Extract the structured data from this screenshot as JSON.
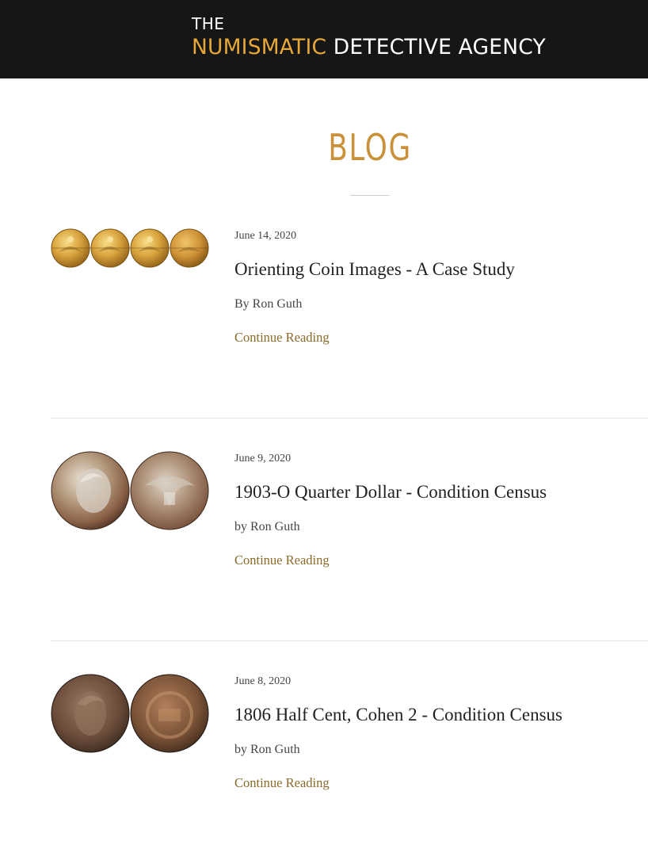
{
  "header": {
    "logo_top": "THE",
    "logo_accent": "NUMISMATIC",
    "logo_rest": "DETECTIVE AGENCY"
  },
  "page": {
    "title": "BLOG"
  },
  "posts": [
    {
      "date": "June 14, 2020",
      "title": "Orienting Coin Images - A Case Study",
      "author": "By Ron Guth",
      "link": "Continue Reading",
      "thumb": {
        "coins": 4,
        "style": "gold"
      }
    },
    {
      "date": "June 9, 2020",
      "title": "1903-O Quarter Dollar - Condition Census",
      "author": "by Ron Guth",
      "link": "Continue Reading",
      "thumb": {
        "coins": 2,
        "style": "silver"
      }
    },
    {
      "date": "June 8, 2020",
      "title": "1806 Half Cent, Cohen 2 - Condition Census",
      "author": "by Ron Guth",
      "link": "Continue Reading",
      "thumb": {
        "coins": 2,
        "style": "copper"
      }
    }
  ],
  "colors": {
    "header_bg": "#161616",
    "logo_accent": "#e8a838",
    "blog_title": "#c9913a",
    "link": "#8a6a2a"
  }
}
